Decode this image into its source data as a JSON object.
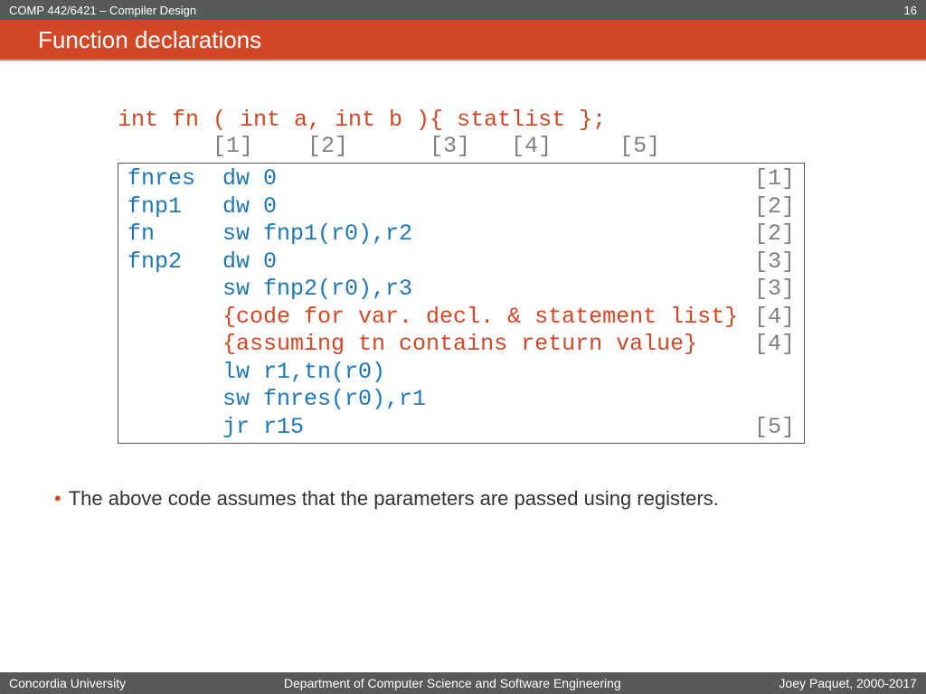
{
  "header": {
    "course": "COMP 442/6421 – Compiler Design",
    "page_number": "16"
  },
  "title": "Function declarations",
  "declaration": "int fn ( int a, int b ){ statlist };",
  "markers": "       [1]    [2]      [3]   [4]     [5]",
  "code_rows": [
    {
      "left": "fnres  dw 0",
      "tag": "[1]",
      "class": ""
    },
    {
      "left": "fnp1   dw 0",
      "tag": "[2]",
      "class": ""
    },
    {
      "left": "fn     sw fnp1(r0),r2",
      "tag": "[2]",
      "class": ""
    },
    {
      "left": "fnp2   dw 0",
      "tag": "[3]",
      "class": ""
    },
    {
      "left": "       sw fnp2(r0),r3",
      "tag": "[3]",
      "class": ""
    },
    {
      "left": "       {code for var. decl. & statement list}",
      "tag": "[4]",
      "class": "orange"
    },
    {
      "left": "       {assuming tn contains return value}",
      "tag": "[4]",
      "class": "orange"
    },
    {
      "left": "       lw r1,tn(r0)",
      "tag": "",
      "class": ""
    },
    {
      "left": "       sw fnres(r0),r1",
      "tag": "",
      "class": ""
    },
    {
      "left": "       jr r15",
      "tag": "[5]",
      "class": ""
    }
  ],
  "bullet": "The above code assumes that the parameters are passed using registers.",
  "footer": {
    "left": "Concordia University",
    "center": "Department of Computer Science and Software Engineering",
    "right": "Joey Paquet, 2000-2017"
  }
}
